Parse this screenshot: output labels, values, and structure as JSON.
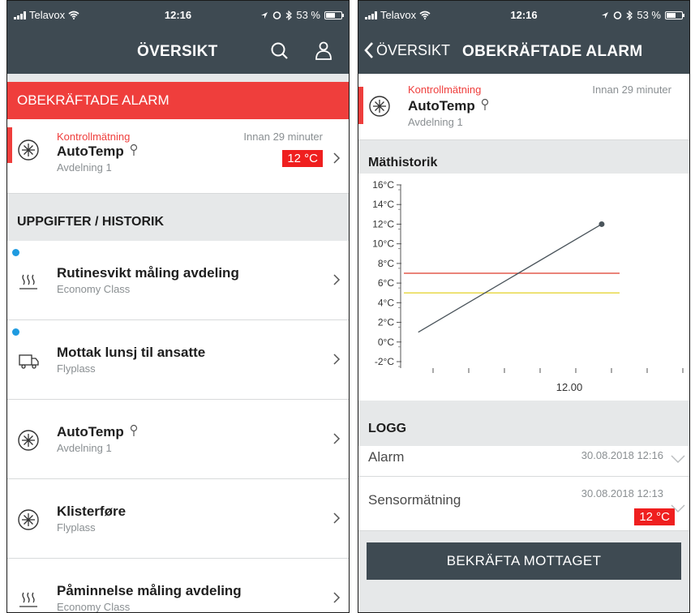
{
  "status": {
    "carrier": "Telavox",
    "time": "12:16",
    "battery": "53 %",
    "battery_level": 0.53
  },
  "left": {
    "nav_title": "ÖVERSIKT",
    "icons": [
      "search-icon",
      "user-icon"
    ],
    "alarm_header": "OBEKRÄFTADE ALARM",
    "alarm_item": {
      "kind": "Kontrollmätning",
      "ago": "Innan 29 minuter",
      "title": "AutoTemp",
      "sub": "Avdelning 1",
      "value": "12 °C",
      "icon": "snowflake-icon"
    },
    "tasks_header": "UPPGIFTER / HISTORIK",
    "tasks": [
      {
        "title": "Rutinesvikt måling avdeling",
        "sub": "Economy Class",
        "icon": "heat-icon",
        "unread": true
      },
      {
        "title": "Mottak lunsj til ansatte",
        "sub": "Flyplass",
        "icon": "truck-icon",
        "unread": true
      },
      {
        "title": "AutoTemp",
        "sub": "Avdelning 1",
        "icon": "snowflake-icon",
        "unread": false,
        "sensor": true
      },
      {
        "title": "Klisterføre",
        "sub": "Flyplass",
        "icon": "snowflake-icon",
        "unread": false
      },
      {
        "title": "Påminnelse måling avdeling",
        "sub": "Economy Class",
        "icon": "heat-icon",
        "unread": false
      }
    ]
  },
  "right": {
    "back_label": "ÖVERSIKT",
    "nav_title": "OBEKRÄFTADE ALARM",
    "alarm_item": {
      "kind": "Kontrollmätning",
      "ago": "Innan 29 minuter",
      "title": "AutoTemp",
      "sub": "Avdelning 1"
    },
    "history_header": "Mäthistorik",
    "log_header": "LOGG",
    "log": [
      {
        "label": "Alarm",
        "timestamp": "30.08.2018 12:16"
      },
      {
        "label": "Sensormätning",
        "timestamp": "30.08.2018 12:13",
        "value": "12 °C"
      }
    ],
    "confirm_label": "BEKRÄFTA MOTTAGET"
  },
  "colors": {
    "nav": "#3e4a52",
    "alarm": "#ef3e3c",
    "unread_dot": "#1f9be0",
    "limit_high": "#e35b4f",
    "limit_low": "#e8d94a"
  },
  "chart_data": {
    "type": "line",
    "title": "Mäthistorik",
    "y_ticks": [
      "16°C",
      "14°C",
      "12°C",
      "10°C",
      "8°C",
      "6°C",
      "4°C",
      "2°C",
      "0°C",
      "-2°C"
    ],
    "x_tick_label": "12.00",
    "ylim": [
      -2,
      16
    ],
    "series": [
      {
        "points": [
          [
            -0.5,
            1
          ],
          [
            4.7,
            12
          ]
        ]
      }
    ],
    "limits": [
      {
        "value": 7,
        "color": "#e35b4f"
      },
      {
        "value": 5,
        "color": "#e8d94a"
      }
    ],
    "grid": false
  }
}
